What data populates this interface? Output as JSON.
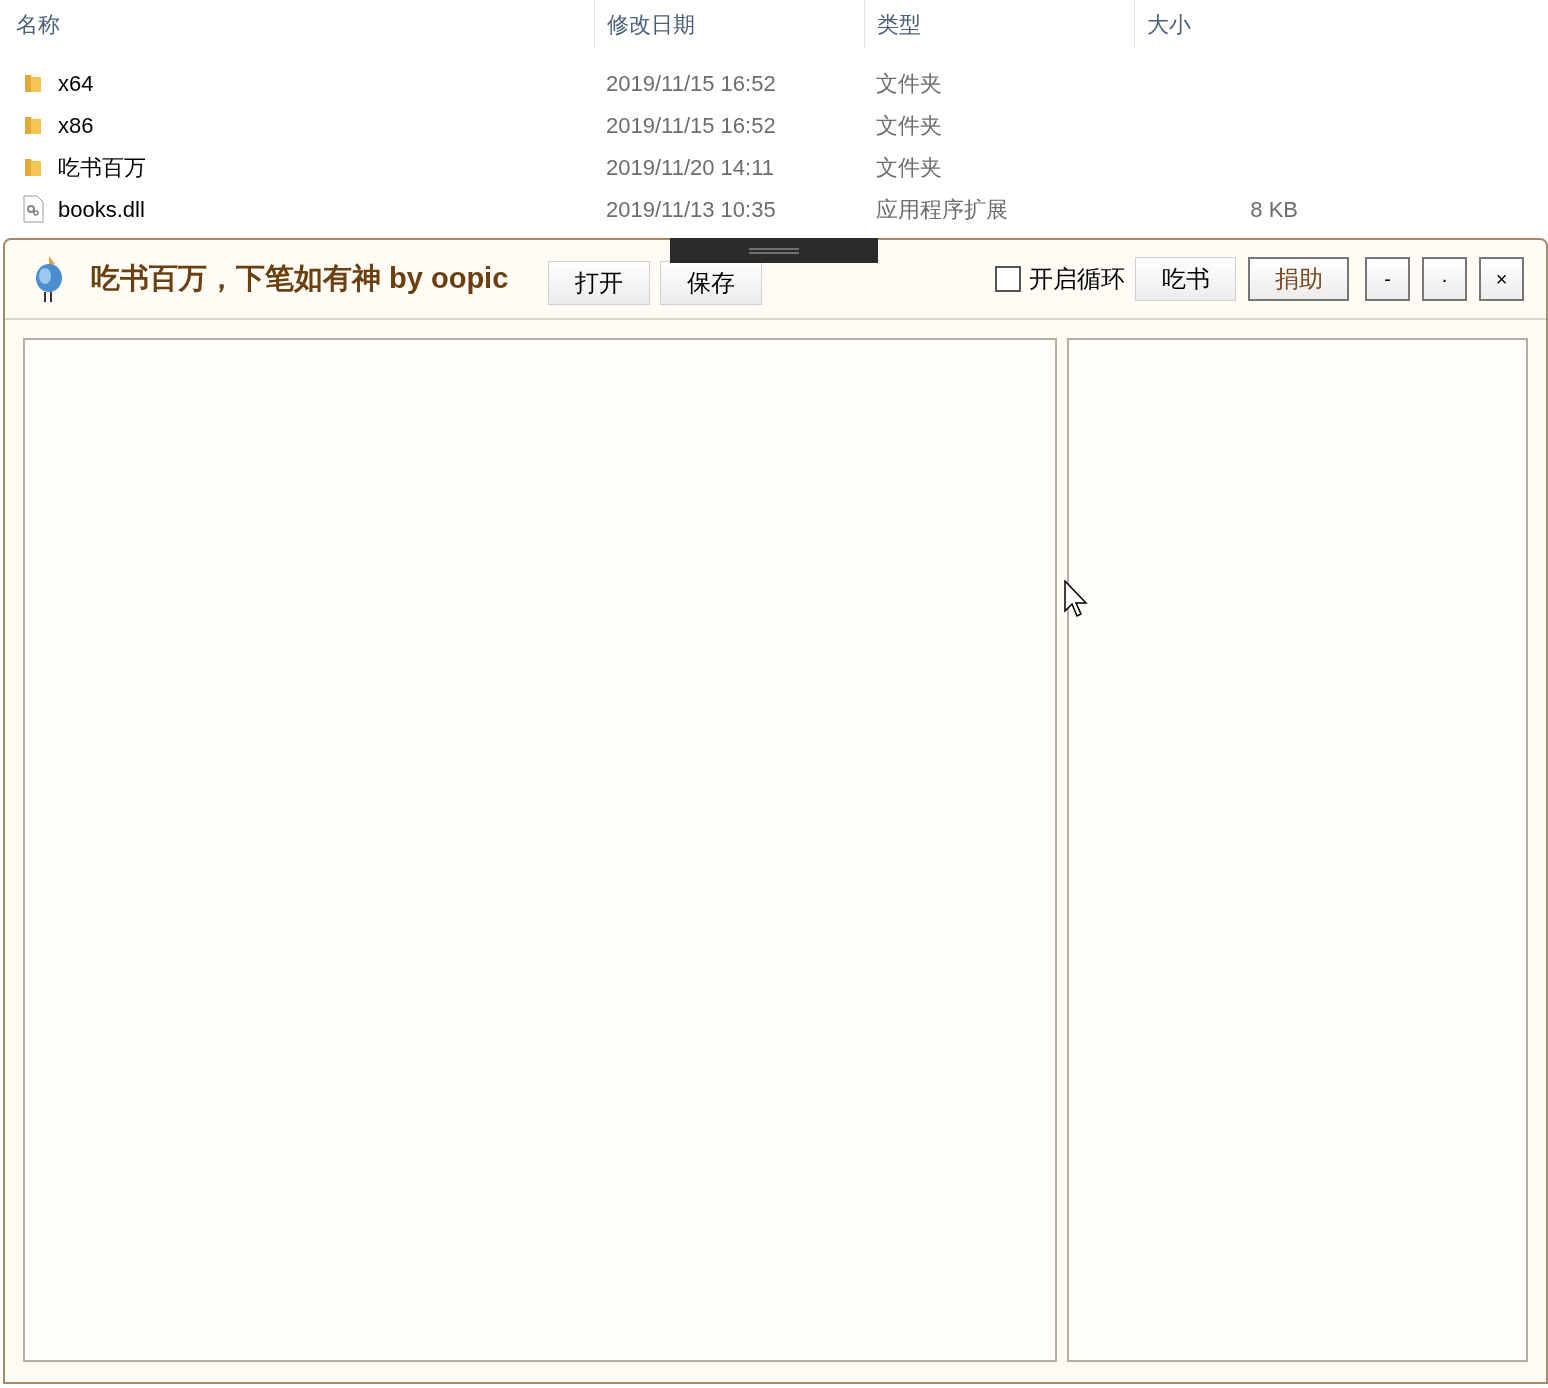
{
  "explorer": {
    "columns": [
      "名称",
      "修改日期",
      "类型",
      "大小"
    ],
    "rows": [
      {
        "kind": "folder",
        "name": "x64",
        "date": "2019/11/15 16:52",
        "type": "文件夹"
      },
      {
        "kind": "folder",
        "name": "x86",
        "date": "2019/11/15 16:52",
        "type": "文件夹"
      },
      {
        "kind": "folder",
        "name": "吃书百万",
        "date": "2019/11/20 14:11",
        "type": "文件夹"
      },
      {
        "kind": "file",
        "name": "books.dll",
        "date": "2019/11/13 10:35",
        "type": "应用程序扩展",
        "size": "8 KB"
      }
    ]
  },
  "app": {
    "title": "吃书百万，下笔如有神 by oopic",
    "file_buttons": [
      "打开",
      "保存"
    ],
    "loop": {
      "label": "开启循环",
      "checked": false
    },
    "actions": [
      {
        "label": "吃书",
        "kind": "plain"
      },
      {
        "label": "捐助",
        "kind": "accent"
      }
    ],
    "window_controls": [
      "-",
      "·",
      "×"
    ]
  }
}
